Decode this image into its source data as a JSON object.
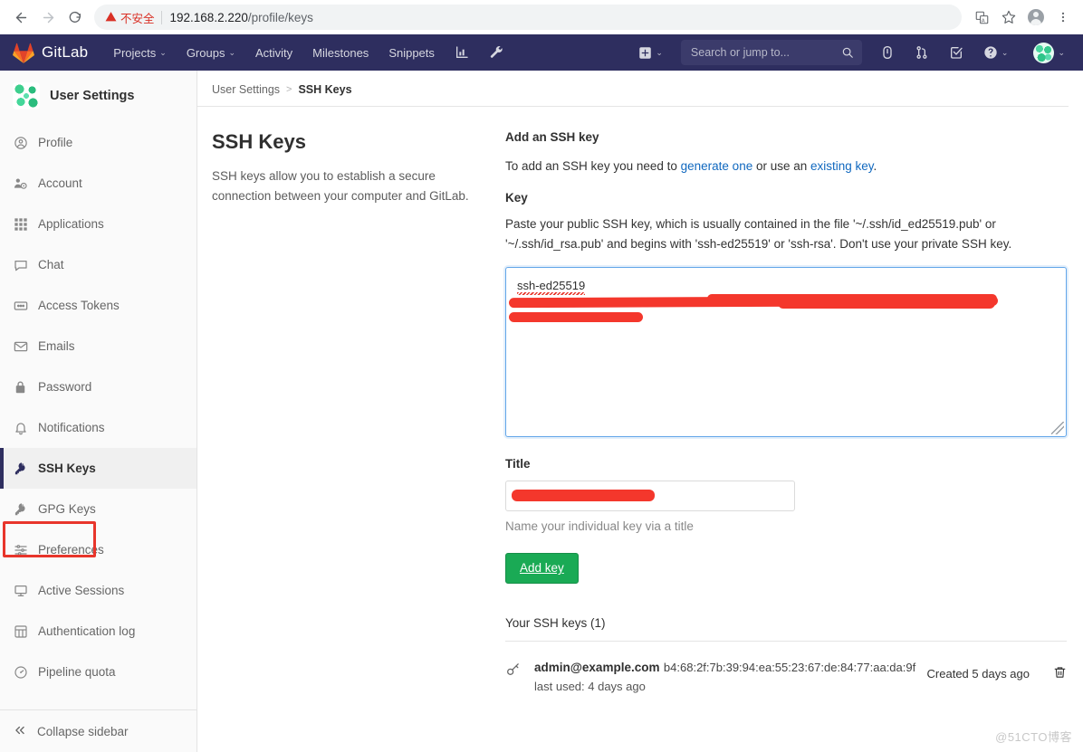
{
  "browser": {
    "back_icon": "back-arrow-icon",
    "forward_icon": "forward-arrow-icon",
    "reload_icon": "reload-icon",
    "security_warning": "不安全",
    "url_host": "192.168.2.220",
    "url_path": "/profile/keys",
    "translate_icon": "translate-icon",
    "bookmark_icon": "star-icon",
    "profile_icon": "profile-avatar-icon",
    "menu_icon": "three-dot-menu-icon"
  },
  "navbar": {
    "brand": "GitLab",
    "items": [
      {
        "label": "Projects",
        "caret": "⌄"
      },
      {
        "label": "Groups",
        "caret": "⌄"
      },
      {
        "label": "Activity",
        "caret": ""
      },
      {
        "label": "Milestones",
        "caret": ""
      },
      {
        "label": "Snippets",
        "caret": ""
      }
    ],
    "analytics_icon": "chart-icon",
    "admin_icon": "wrench-icon",
    "plus_icon": "plus-square-icon",
    "plus_caret": "⌄",
    "search_placeholder": "Search or jump to...",
    "search_value": "",
    "search_icon": "search-icon",
    "issues_icon": "issues-icon",
    "merge_requests_icon": "merge-request-icon",
    "todos_icon": "todos-icon",
    "help_icon": "help-icon",
    "help_caret": "⌄",
    "avatar_icon": "user-avatar",
    "avatar_caret": "⌄"
  },
  "sidebar": {
    "title": "User Settings",
    "avatar_icon": "user-avatar",
    "items": [
      {
        "label": "Profile",
        "icon": "profile-icon",
        "active": false
      },
      {
        "label": "Account",
        "icon": "account-icon",
        "active": false
      },
      {
        "label": "Applications",
        "icon": "applications-icon",
        "active": false
      },
      {
        "label": "Chat",
        "icon": "chat-icon",
        "active": false
      },
      {
        "label": "Access Tokens",
        "icon": "token-icon",
        "active": false
      },
      {
        "label": "Emails",
        "icon": "envelope-icon",
        "active": false
      },
      {
        "label": "Password",
        "icon": "lock-icon",
        "active": false
      },
      {
        "label": "Notifications",
        "icon": "bell-icon",
        "active": false
      },
      {
        "label": "SSH Keys",
        "icon": "key-icon",
        "active": true
      },
      {
        "label": "GPG Keys",
        "icon": "key-icon",
        "active": false
      },
      {
        "label": "Preferences",
        "icon": "sliders-icon",
        "active": false
      },
      {
        "label": "Active Sessions",
        "icon": "monitor-icon",
        "active": false
      },
      {
        "label": "Authentication log",
        "icon": "log-icon",
        "active": false
      },
      {
        "label": "Pipeline quota",
        "icon": "quota-icon",
        "active": false
      }
    ],
    "collapse_label": "Collapse sidebar",
    "collapse_icon": "chevron-double-left-icon",
    "annotation_color": "#e8352b"
  },
  "breadcrumb": {
    "root": "User Settings",
    "separator": ">",
    "current": "SSH Keys"
  },
  "main": {
    "page_title": "SSH Keys",
    "page_description": "SSH keys allow you to establish a secure connection between your computer and GitLab.",
    "form": {
      "section_title": "Add an SSH key",
      "intro_prefix": "To add an SSH key you need to ",
      "link_generate": "generate one",
      "intro_middle": " or use an ",
      "link_existing": "existing key",
      "intro_suffix": ".",
      "key_label": "Key",
      "key_hint": "Paste your public SSH key, which is usually contained in the file '~/.ssh/id_ed25519.pub' or '~/.ssh/id_rsa.pub' and begins with 'ssh-ed25519' or 'ssh-rsa'. Don't use your private SSH key.",
      "key_value": "ssh-ed25519",
      "title_label": "Title",
      "title_value": "",
      "title_hint": "Name your individual key via a title",
      "submit_label": "Add key",
      "submit_color": "#1aaa55"
    },
    "keys_list": {
      "heading": "Your SSH keys (1)",
      "rows": [
        {
          "icon": "key-icon",
          "name": "admin@example.com",
          "fingerprint": "b4:68:2f:7b:39:94:ea:55:23:67:de:84:77:aa:da:9f",
          "last_used": "last used: 4 days ago",
          "created": "Created 5 days ago",
          "delete_icon": "trash-icon"
        }
      ]
    }
  },
  "watermark": "@51CTO博客"
}
